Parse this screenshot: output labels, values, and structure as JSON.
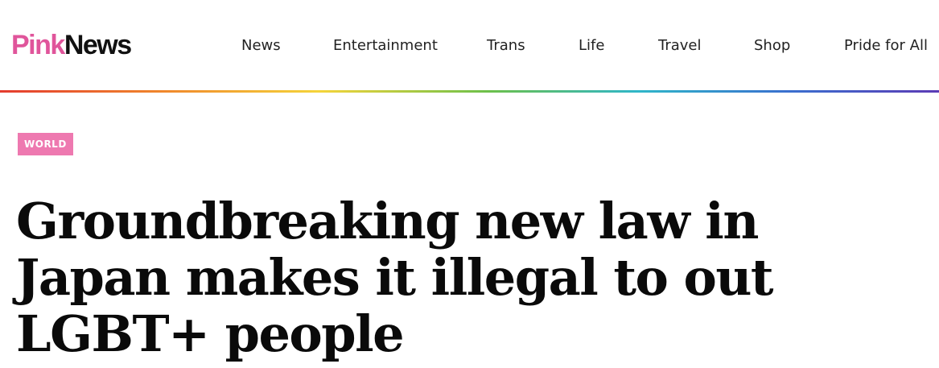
{
  "header": {
    "logo": {
      "part1": "Pink",
      "part2": "News"
    },
    "nav": [
      {
        "label": "News"
      },
      {
        "label": "Entertainment"
      },
      {
        "label": "Trans"
      },
      {
        "label": "Life"
      },
      {
        "label": "Travel"
      },
      {
        "label": "Shop"
      },
      {
        "label": "Pride for All"
      }
    ]
  },
  "article": {
    "category": "WORLD",
    "headline": "Groundbreaking new law in Japan makes it illegal to out LGBT+ people"
  },
  "colors": {
    "brand_pink": "#e0559b",
    "badge_pink": "#ee79b0",
    "text": "#111111"
  }
}
